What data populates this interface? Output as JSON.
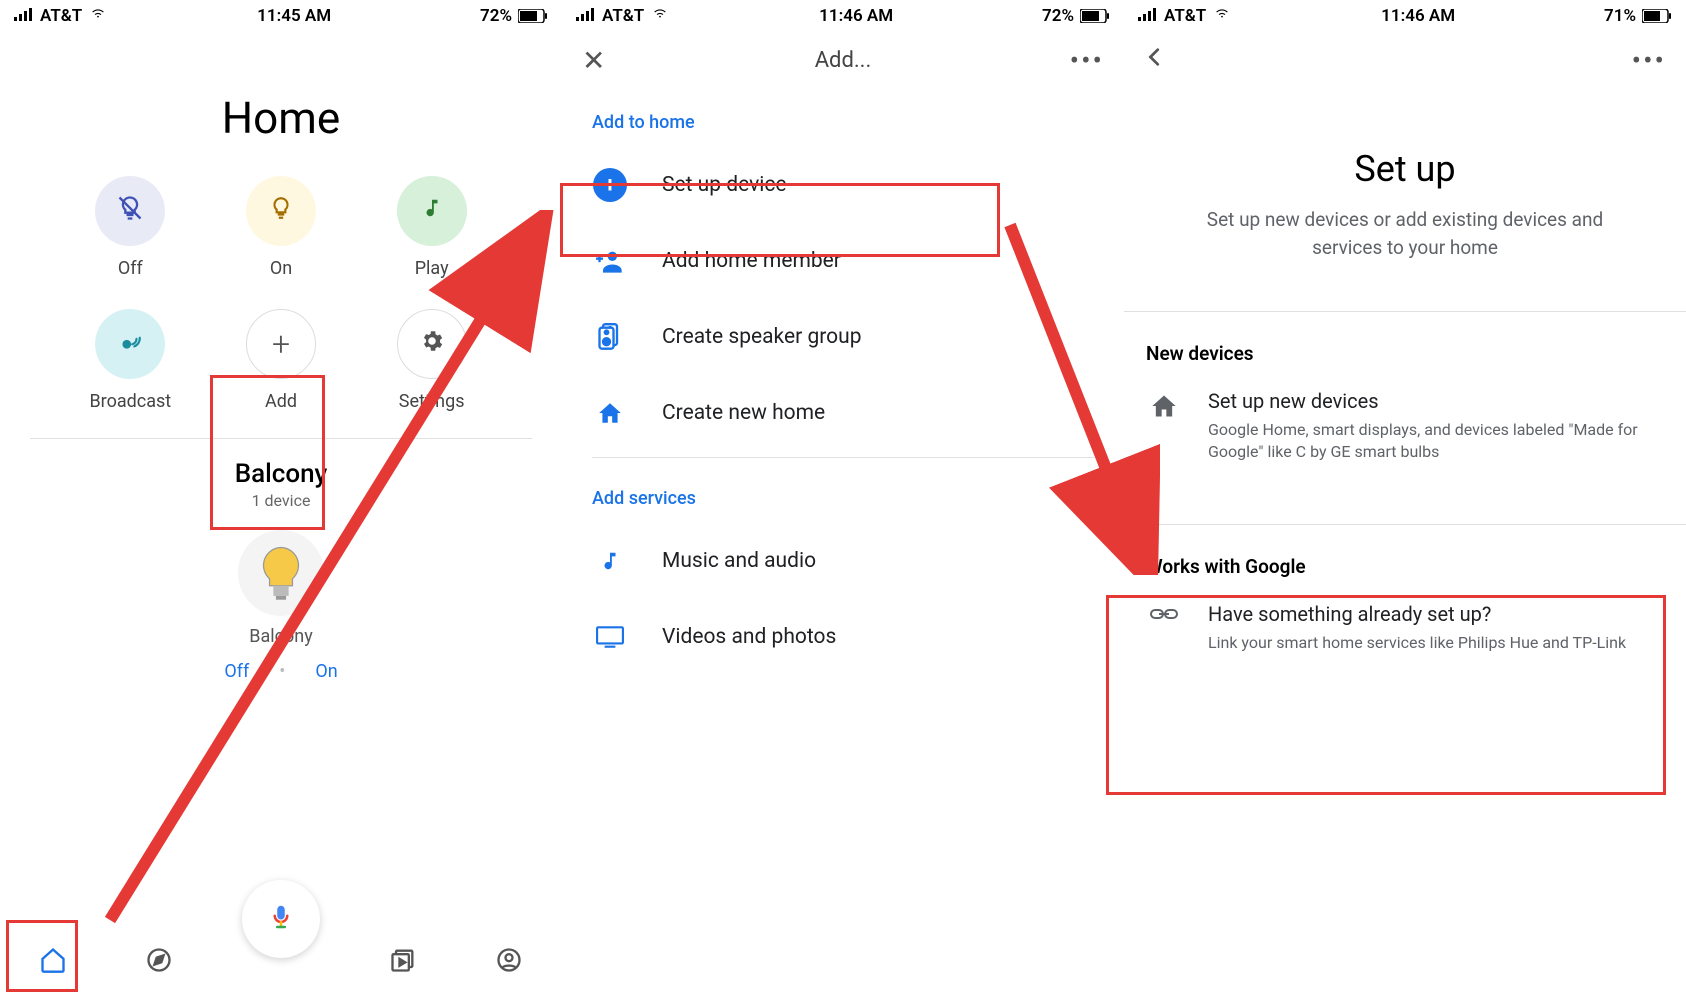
{
  "status1": {
    "carrier": "AT&T",
    "time": "11:45 AM",
    "battery": "72%"
  },
  "status2": {
    "carrier": "AT&T",
    "time": "11:46 AM",
    "battery": "72%"
  },
  "status3": {
    "carrier": "AT&T",
    "time": "11:46 AM",
    "battery": "71%"
  },
  "screen1": {
    "title": "Home",
    "actions": {
      "off": "Off",
      "on": "On",
      "play": "Play",
      "broadcast": "Broadcast",
      "add": "Add",
      "settings": "Settings"
    },
    "room": {
      "name": "Balcony",
      "sub": "1 device",
      "device": "Balcony",
      "off": "Off",
      "on": "On"
    }
  },
  "screen2": {
    "title": "Add...",
    "section1": "Add to home",
    "items1": [
      "Set up device",
      "Add home member",
      "Create speaker group",
      "Create new home"
    ],
    "section2": "Add services",
    "items2": [
      "Music and audio",
      "Videos and photos"
    ]
  },
  "screen3": {
    "title": "Set up",
    "subtitle": "Set up new devices or add existing devices and services to your home",
    "sec1": "New devices",
    "item1": {
      "title": "Set up new devices",
      "sub": "Google Home, smart displays, and devices labeled \"Made for Google\" like C by GE smart bulbs"
    },
    "sec2": "Works with Google",
    "item2": {
      "title": "Have something already set up?",
      "sub": "Link your smart home services like Philips Hue and TP-Link"
    }
  }
}
